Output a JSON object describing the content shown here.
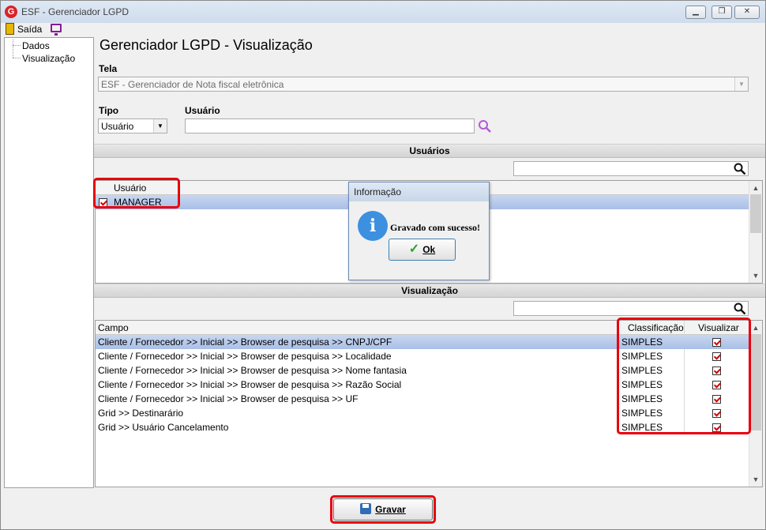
{
  "window": {
    "title": "ESF - Gerenciador LGPD",
    "app_icon_letter": "G"
  },
  "menu": {
    "exit_label": "Saída"
  },
  "tree": {
    "items": [
      "Dados",
      "Visualização"
    ]
  },
  "page": {
    "title": "Gerenciador LGPD - Visualização"
  },
  "form": {
    "tela_label": "Tela",
    "tela_value": "ESF - Gerenciador de Nota fiscal eletrônica",
    "tipo_label": "Tipo",
    "tipo_value": "Usuário",
    "usuario_label": "Usuário",
    "usuario_value": ""
  },
  "users_section": {
    "header": "Usuários",
    "column": "Usuário",
    "rows": [
      {
        "name": "MANAGER",
        "checked": true
      }
    ]
  },
  "view_section": {
    "header": "Visualização",
    "columns": {
      "campo": "Campo",
      "classificacao": "Classificação",
      "visualizar": "Visualizar"
    },
    "rows": [
      {
        "campo": "Cliente / Fornecedor >> Inicial >> Browser de pesquisa >> CNPJ/CPF",
        "classificacao": "SIMPLES",
        "visualizar": true
      },
      {
        "campo": "Cliente / Fornecedor >> Inicial >> Browser de pesquisa >> Localidade",
        "classificacao": "SIMPLES",
        "visualizar": true
      },
      {
        "campo": "Cliente / Fornecedor >> Inicial >> Browser de pesquisa >> Nome fantasia",
        "classificacao": "SIMPLES",
        "visualizar": true
      },
      {
        "campo": "Cliente / Fornecedor >> Inicial >> Browser de pesquisa >> Razão Social",
        "classificacao": "SIMPLES",
        "visualizar": true
      },
      {
        "campo": "Cliente / Fornecedor >> Inicial >> Browser de pesquisa >> UF",
        "classificacao": "SIMPLES",
        "visualizar": true
      },
      {
        "campo": "Grid >> Destinarário",
        "classificacao": "SIMPLES",
        "visualizar": true
      },
      {
        "campo": "Grid >> Usuário Cancelamento",
        "classificacao": "SIMPLES",
        "visualizar": true
      }
    ]
  },
  "dialog": {
    "title": "Informação",
    "message": "Gravado com sucesso!",
    "ok_label": "Ok"
  },
  "actions": {
    "save_label": "Gravar"
  },
  "colors": {
    "highlight_outline": "#e8000b",
    "selection": "#a9bfe6",
    "check": "#d40000"
  }
}
